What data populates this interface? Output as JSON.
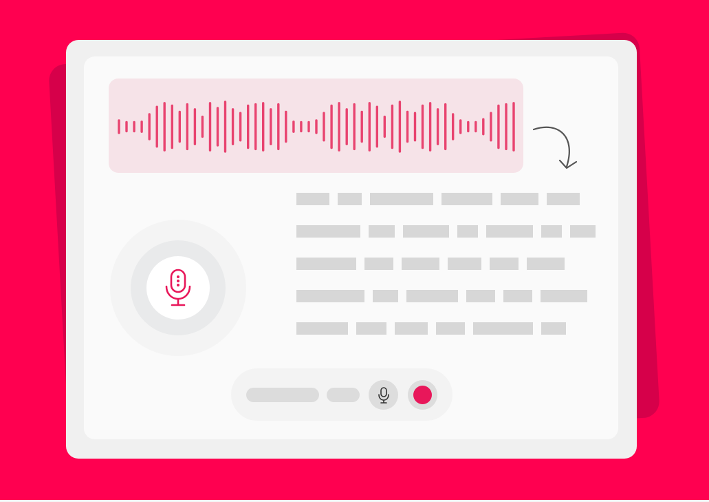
{
  "illustration": {
    "subject": "speech-to-text",
    "background_color": "#FF0050",
    "accent_color": "#E8175A",
    "waveform_color": "#E8436F",
    "placeholder_color": "#d7d7d7"
  },
  "waveform": {
    "bar_levels": [
      0.25,
      0.18,
      0.18,
      0.2,
      0.5,
      0.8,
      0.95,
      0.85,
      0.6,
      0.9,
      0.7,
      0.4,
      0.95,
      0.75,
      1.0,
      0.7,
      0.55,
      0.85,
      0.9,
      0.95,
      0.7,
      0.9,
      0.6,
      0.2,
      0.18,
      0.18,
      0.25,
      0.55,
      0.85,
      0.95,
      0.7,
      0.9,
      0.6,
      0.95,
      0.8,
      0.4,
      0.85,
      1.0,
      0.6,
      0.55,
      0.85,
      0.95,
      0.7,
      0.9,
      0.5,
      0.25,
      0.18,
      0.18,
      0.3,
      0.55,
      0.85,
      0.9,
      0.95
    ]
  },
  "transcript": {
    "lines": [
      [
        48,
        35,
        92,
        74,
        55,
        48
      ],
      [
        93,
        38,
        67,
        30,
        68,
        30,
        37
      ],
      [
        87,
        42,
        55,
        49,
        42,
        55
      ],
      [
        99,
        37,
        75,
        42,
        42,
        68
      ],
      [
        75,
        44,
        48,
        42,
        87,
        36
      ]
    ]
  },
  "controls": {
    "mic_icon": "microphone-icon",
    "record_icon": "record-icon",
    "record_color": "#E8175A"
  },
  "orb": {
    "icon": "microphone-icon"
  }
}
